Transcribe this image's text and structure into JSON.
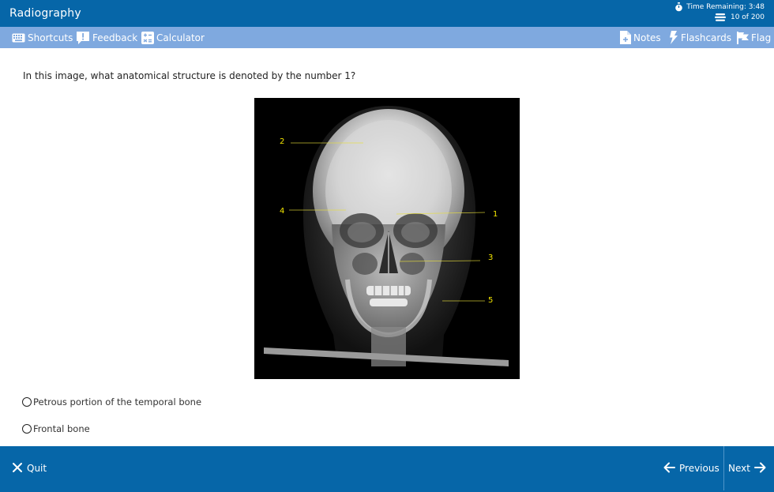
{
  "header": {
    "title": "Radiography",
    "timer_text": "Time Remaining: 3:48",
    "progress_text": "10 of 200"
  },
  "toolbar": {
    "left": [
      {
        "label": "Shortcuts",
        "icon": "keyboard-icon"
      },
      {
        "label": "Feedback",
        "icon": "feedback-icon"
      },
      {
        "label": "Calculator",
        "icon": "calculator-icon"
      }
    ],
    "right": [
      {
        "label": "Notes",
        "icon": "notes-icon"
      },
      {
        "label": "Flashcards",
        "icon": "flashcards-icon"
      },
      {
        "label": "Flag",
        "icon": "flag-icon"
      }
    ]
  },
  "question": {
    "text": "In this image, what anatomical structure is denoted by the number 1?",
    "image": {
      "labels": [
        "1",
        "2",
        "3",
        "4",
        "5"
      ],
      "label_color": "#f2e400"
    }
  },
  "options": [
    {
      "label": "Petrous portion of the temporal bone",
      "selected": false
    },
    {
      "label": "Frontal bone",
      "selected": false
    }
  ],
  "footer": {
    "quit_label": "Quit",
    "previous_label": "Previous",
    "next_label": "Next"
  },
  "colors": {
    "primary": "#0666a8",
    "toolbar": "#7fa9df"
  }
}
